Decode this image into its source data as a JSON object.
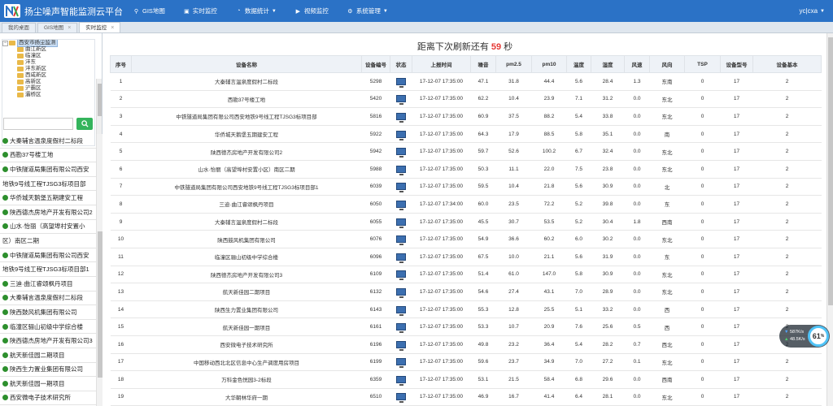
{
  "app": {
    "title": "扬尘噪声智能监测云平台"
  },
  "nav": [
    {
      "icon": "map-marker-icon",
      "glyph": "⚲",
      "label": "GIS地图",
      "dropdown": false
    },
    {
      "icon": "monitor-icon",
      "glyph": "▣",
      "label": "实时监控",
      "dropdown": false
    },
    {
      "icon": "chart-icon",
      "glyph": "◔",
      "label": "数据统计",
      "dropdown": true
    },
    {
      "icon": "video-icon",
      "glyph": "▶",
      "label": "视频监控",
      "dropdown": false
    },
    {
      "icon": "gear-icon",
      "glyph": "⚙",
      "label": "系统管理",
      "dropdown": true
    }
  ],
  "user": {
    "name": "yc|cxa"
  },
  "tabs": [
    {
      "label": "我的桌面",
      "active": false,
      "closable": false
    },
    {
      "label": "GIS地图",
      "active": false,
      "closable": true
    },
    {
      "label": "实时监控",
      "active": true,
      "closable": true
    }
  ],
  "tree": {
    "root": "西安市扬尘监测",
    "children": [
      "曲江新区",
      "临潼区",
      "沣东",
      "沣东新区",
      "西咸新区",
      "高新区",
      "浐霸区",
      "灞桥区"
    ]
  },
  "search": {
    "placeholder": "",
    "button_icon": "search-icon"
  },
  "sites": [
    {
      "text": "大秦辅言温泉度假村二标段",
      "dot": true
    },
    {
      "text": "西勘37号楼工地",
      "dot": true
    },
    {
      "text": "中铁隧道局集团有限公司西安",
      "dot": true
    },
    {
      "text": "地铁9号线工程TJSG3标项目部",
      "dot": false
    },
    {
      "text": "华侨城天鹅堡五期建安工程",
      "dot": true
    },
    {
      "text": "陕西德杰房地产开发有限公司2",
      "dot": true
    },
    {
      "text": "山水·怡丽（高望埠村安置小",
      "dot": true
    },
    {
      "text": "区）南区二期",
      "dot": false
    },
    {
      "text": "中铁隧道局集团有限公司西安",
      "dot": true
    },
    {
      "text": "地铁9号线工程TJSG3标项目部1",
      "dot": false
    },
    {
      "text": "三迪·曲江睿颂枫丹项目",
      "dot": true
    },
    {
      "text": "大秦辅言温泉度假村二标段",
      "dot": true
    },
    {
      "text": "陕西鼓风机集团有限公司",
      "dot": true
    },
    {
      "text": "临潼区骊山初级中学综合楼",
      "dot": true
    },
    {
      "text": "陕西德杰房地产开发有限公司3",
      "dot": true
    },
    {
      "text": "航天新佳园二期项目",
      "dot": true
    },
    {
      "text": "陕西生力置业集团有限公司",
      "dot": true
    },
    {
      "text": "航天新佳园一期项目",
      "dot": true
    },
    {
      "text": "西安微电子技术研究所",
      "dot": true
    }
  ],
  "countdown": {
    "prefix": "距离下次刷新还有",
    "seconds": "59",
    "suffix": "秒"
  },
  "table": {
    "columns": [
      "序号",
      "设备名称",
      "设备编号",
      "状态",
      "上报时间",
      "噪音",
      "pm2.5",
      "pm10",
      "温度",
      "湿度",
      "风速",
      "风向",
      "TSP",
      "设备型号",
      "设备基本"
    ],
    "rows": [
      [
        "1",
        "大秦辅言温泉度假村二标段",
        "5298",
        "",
        "17-12-07 17:35:00",
        "47.1",
        "31.8",
        "44.4",
        "5.6",
        "28.4",
        "1.3",
        "东南",
        "0",
        "17",
        "2"
      ],
      [
        "2",
        "西勘37号楼工地",
        "5420",
        "",
        "17-12-07 17:35:00",
        "62.2",
        "10.4",
        "23.9",
        "7.1",
        "31.2",
        "0.0",
        "东北",
        "0",
        "17",
        "2"
      ],
      [
        "3",
        "中铁隧道局集团有限公司西安地铁9号线工程TJSG3标项目部",
        "5816",
        "",
        "17-12-07 17:35:00",
        "60.9",
        "37.5",
        "88.2",
        "5.4",
        "33.8",
        "0.0",
        "东北",
        "0",
        "17",
        "2"
      ],
      [
        "4",
        "华侨城天鹅堡五期建安工程",
        "5922",
        "",
        "17-12-07 17:35:00",
        "64.3",
        "17.9",
        "88.5",
        "5.8",
        "35.1",
        "0.0",
        "南",
        "0",
        "17",
        "2"
      ],
      [
        "5",
        "陕西德杰房地产开发有限公司2",
        "5942",
        "",
        "17-12-07 17:35:00",
        "59.7",
        "52.6",
        "100.2",
        "6.7",
        "32.4",
        "0.0",
        "东北",
        "0",
        "17",
        "2"
      ],
      [
        "6",
        "山水·怡丽（高望埠村安置小区）南区二期",
        "5988",
        "",
        "17-12-07 17:35:00",
        "50.3",
        "11.1",
        "22.0",
        "7.5",
        "23.8",
        "0.0",
        "东北",
        "0",
        "17",
        "2"
      ],
      [
        "7",
        "中铁隧道局集团有限公司西安地铁9号线工程TJSG3标项目部1",
        "6039",
        "",
        "17-12-07 17:35:00",
        "59.5",
        "10.4",
        "21.8",
        "5.6",
        "30.9",
        "0.0",
        "北",
        "0",
        "17",
        "2"
      ],
      [
        "8",
        "三迪·曲江睿颂枫丹项目",
        "6050",
        "",
        "17-12-07 17:34:00",
        "60.0",
        "23.5",
        "72.2",
        "5.2",
        "39.8",
        "0.0",
        "东",
        "0",
        "17",
        "2"
      ],
      [
        "9",
        "大秦辅言温泉度假村二标段",
        "6055",
        "",
        "17-12-07 17:35:00",
        "45.5",
        "30.7",
        "53.5",
        "5.2",
        "30.4",
        "1.8",
        "西南",
        "0",
        "17",
        "2"
      ],
      [
        "10",
        "陕西鼓风机集团有限公司",
        "6076",
        "",
        "17-12-07 17:35:00",
        "54.9",
        "36.6",
        "60.2",
        "6.0",
        "30.2",
        "0.0",
        "东北",
        "0",
        "17",
        "2"
      ],
      [
        "11",
        "临潼区骊山初级中学综合楼",
        "6096",
        "",
        "17-12-07 17:35:00",
        "67.5",
        "10.0",
        "21.1",
        "5.6",
        "31.9",
        "0.0",
        "东",
        "0",
        "17",
        "2"
      ],
      [
        "12",
        "陕西德杰房地产开发有限公司3",
        "6109",
        "",
        "17-12-07 17:35:00",
        "51.4",
        "61.0",
        "147.0",
        "5.8",
        "30.9",
        "0.0",
        "东北",
        "0",
        "17",
        "2"
      ],
      [
        "13",
        "航天新佳园二期项目",
        "6132",
        "",
        "17-12-07 17:35:00",
        "54.6",
        "27.4",
        "43.1",
        "7.0",
        "28.9",
        "0.0",
        "东北",
        "0",
        "17",
        "2"
      ],
      [
        "14",
        "陕西生力置业集团有限公司",
        "6143",
        "",
        "17-12-07 17:35:00",
        "55.3",
        "12.8",
        "25.5",
        "5.1",
        "33.2",
        "0.0",
        "西",
        "0",
        "17",
        "2"
      ],
      [
        "15",
        "航天新佳园一期项目",
        "6161",
        "",
        "17-12-07 17:35:00",
        "53.3",
        "10.7",
        "20.9",
        "7.6",
        "25.6",
        "0.5",
        "西",
        "0",
        "17",
        "2"
      ],
      [
        "16",
        "西安微电子技术研究所",
        "6196",
        "",
        "17-12-07 17:35:00",
        "49.8",
        "23.2",
        "36.4",
        "5.4",
        "28.2",
        "0.7",
        "西北",
        "0",
        "17",
        "2"
      ],
      [
        "17",
        "中国移动西北北区信息中心生产调度用房项目",
        "6199",
        "",
        "17-12-07 17:35:00",
        "59.6",
        "23.7",
        "34.9",
        "7.0",
        "27.2",
        "0.1",
        "东北",
        "0",
        "17",
        "2"
      ],
      [
        "18",
        "万科金色悦园3-2标段",
        "6359",
        "",
        "17-12-07 17:35:00",
        "53.1",
        "21.5",
        "58.4",
        "6.8",
        "29.6",
        "0.0",
        "西南",
        "0",
        "17",
        "2"
      ],
      [
        "19",
        "大华朝林华府一期",
        "6510",
        "",
        "17-12-07 17:35:00",
        "46.9",
        "16.7",
        "41.4",
        "6.4",
        "28.1",
        "0.0",
        "东北",
        "0",
        "17",
        "2"
      ]
    ]
  },
  "network_widget": {
    "down": "587",
    "down_unit": "K/s",
    "up": "48.5",
    "up_unit": "K/s",
    "percent": "61",
    "percent_unit": "%"
  }
}
